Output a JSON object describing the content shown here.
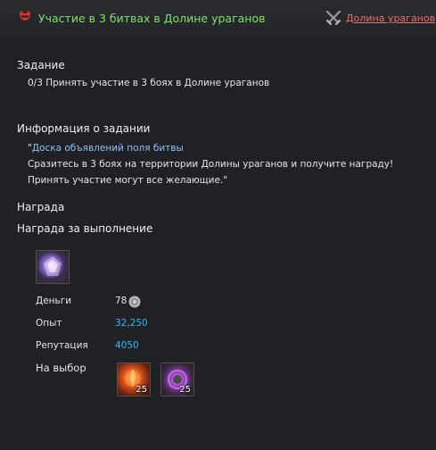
{
  "header": {
    "title": "Участие в 3 битвах в Долине ураганов",
    "region_link": "Долина ураганов",
    "title_icon": "quest-mask-icon",
    "region_icon": "crossed-swords-icon",
    "title_color": "#7ee06a",
    "link_color": "#e8746a"
  },
  "objective": {
    "heading": "Задание",
    "text": "0/3 Принять участие в 3 боях в Долине ураганов"
  },
  "info": {
    "heading": "Информация о задании",
    "quote_open": "\"",
    "source": "Доска объявлений поля битвы",
    "line1": "Сразитесь в 3 боях на территории Долины ураганов и получите награду!",
    "line2": "Принять участие могут все желающие.\""
  },
  "reward": {
    "heading": "Награда",
    "completion_heading": "Награда за выполнение",
    "item_icon": "crystal-box-icon",
    "money_label": "Деньги",
    "money_value": "78",
    "money_icon": "silver-coin-icon",
    "exp_label": "Опыт",
    "exp_value": "32,250",
    "rep_label": "Репутация",
    "rep_value": "4050",
    "choice_label": "На выбор",
    "choices": [
      {
        "icon": "fire-orb-icon",
        "count": "25"
      },
      {
        "icon": "arcane-orb-icon",
        "count": "25"
      }
    ],
    "value_color": "#2fb8ff"
  }
}
